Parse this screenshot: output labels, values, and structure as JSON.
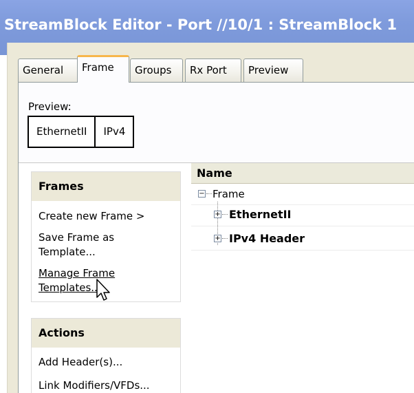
{
  "window": {
    "title": "StreamBlock Editor - Port //10/1 : StreamBlock 1"
  },
  "tabs": [
    {
      "label": "General",
      "active": false
    },
    {
      "label": "Frame",
      "active": true
    },
    {
      "label": "Groups",
      "active": false
    },
    {
      "label": "Rx Port",
      "active": false
    },
    {
      "label": "Preview",
      "active": false
    }
  ],
  "preview": {
    "label": "Preview:",
    "boxes": [
      "EthernetII",
      "IPv4"
    ]
  },
  "frames_section": {
    "header": "Frames",
    "items": [
      "Create new Frame >",
      "Save Frame as Template...",
      "Manage Frame Templates..."
    ]
  },
  "actions_section": {
    "header": "Actions",
    "items": [
      "Add Header(s)...",
      "Link Modifiers/VFDs..."
    ]
  },
  "tree": {
    "column_header": "Name",
    "root": "Frame",
    "children": [
      "EthernetII",
      "IPv4 Header"
    ]
  },
  "colors": {
    "titlebar": "#7f9bdc",
    "dialog_bg": "#ece9d8",
    "active_tab_accent": "#f7b64b"
  },
  "icons": {
    "collapse": "minus-box-icon",
    "expand": "plus-box-icon",
    "pointer": "mouse-cursor-icon"
  }
}
